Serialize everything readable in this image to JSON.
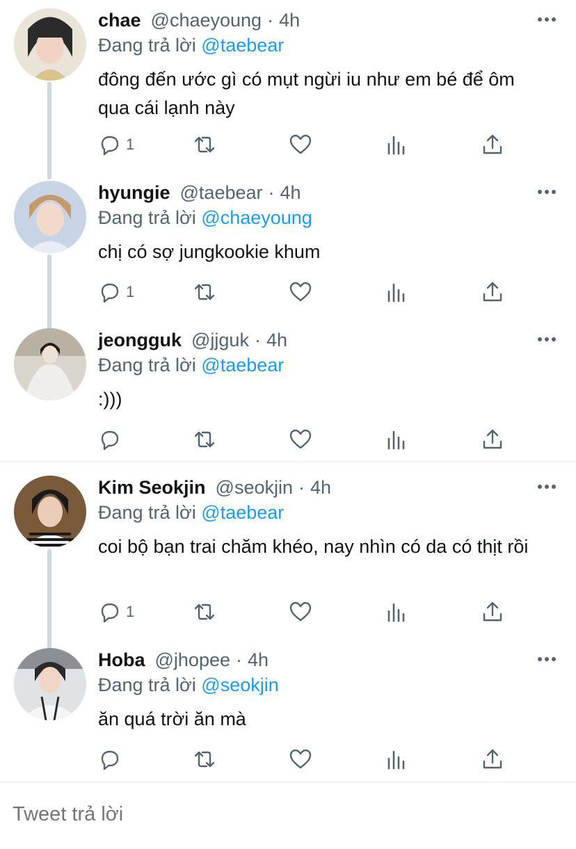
{
  "replying_prefix": "Đang trả lời",
  "tweets": [
    {
      "name": "chae",
      "handle": "@chaeyoung",
      "time": "4h",
      "reply_to": "@taebear",
      "text": "đông đến ước gì có mụt ngừi iu như em bé để ôm qua cái lạnh này",
      "reply_count": "1",
      "avatar_colors": [
        "#e9e3d8",
        "#2b2b2b",
        "#f1d3c4",
        "#d8c38a"
      ]
    },
    {
      "name": "hyungie",
      "handle": "@taebear",
      "time": "4h",
      "reply_to": "@chaeyoung",
      "text": "chị có sợ jungkookie khum",
      "reply_count": "1",
      "avatar_colors": [
        "#c8d3e6",
        "#c59a6a",
        "#f3d9cc",
        "#e8ecf3"
      ]
    },
    {
      "name": "jeongguk",
      "handle": "@jjguk",
      "time": "4h",
      "reply_to": "@taebear",
      "text": ":)))",
      "reply_count": "",
      "avatar_colors": [
        "#d9d4cc",
        "#1e1e1e",
        "#f0eeea",
        "#b9b1a4"
      ]
    },
    {
      "name": "Kim Seokjin",
      "handle": "@seokjin",
      "time": "4h",
      "reply_to": "@taebear",
      "text": "coi bộ bạn trai chăm khéo, nay nhìn có da có thịt rồi",
      "reply_count": "1",
      "avatar_colors": [
        "#7a5a3a",
        "#1a1a1a",
        "#e9cdb9",
        "#f2f2f2"
      ]
    },
    {
      "name": "Hoba",
      "handle": "@jhopee",
      "time": "4h",
      "reply_to": "@seokjin",
      "text": "ăn quá trời ăn mà",
      "reply_count": "",
      "avatar_colors": [
        "#dfe3e6",
        "#2a2a2a",
        "#f1d6c5",
        "#8c8f93"
      ]
    }
  ],
  "composer": {
    "placeholder": "Tweet trả lời"
  },
  "icons": {
    "more": "more-horizontal-icon",
    "reply": "reply-icon",
    "retweet": "retweet-icon",
    "like": "heart-icon",
    "views": "views-icon",
    "share": "share-icon"
  },
  "colors": {
    "mention": "#1d9bf0",
    "secondary": "#536471",
    "thread_line": "#cfd9de"
  }
}
